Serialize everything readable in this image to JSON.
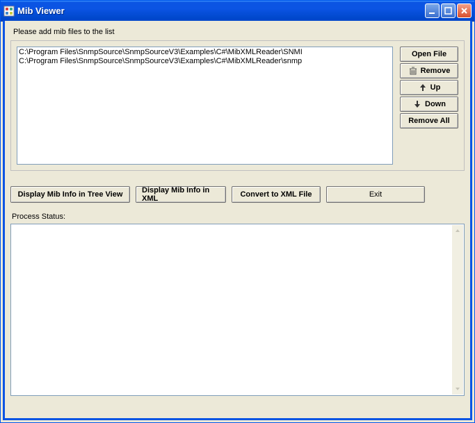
{
  "window": {
    "title": "Mib Viewer"
  },
  "instruction": "Please add mib files to the list",
  "file_list": {
    "items": [
      "C:\\Program Files\\SnmpSource\\SnmpSourceV3\\Examples\\C#\\MibXMLReader\\SNMI",
      "C:\\Program Files\\SnmpSource\\SnmpSourceV3\\Examples\\C#\\MibXMLReader\\snmp"
    ]
  },
  "side_buttons": {
    "open_file": "Open File",
    "remove": "Remove",
    "up": "Up",
    "down": "Down",
    "remove_all": "Remove All"
  },
  "action_buttons": {
    "tree_view": "Display Mib Info in Tree View",
    "xml_view": "Display Mib Info in XML",
    "convert": "Convert to XML File",
    "exit": "Exit"
  },
  "status_label": "Process Status:",
  "status_text": ""
}
